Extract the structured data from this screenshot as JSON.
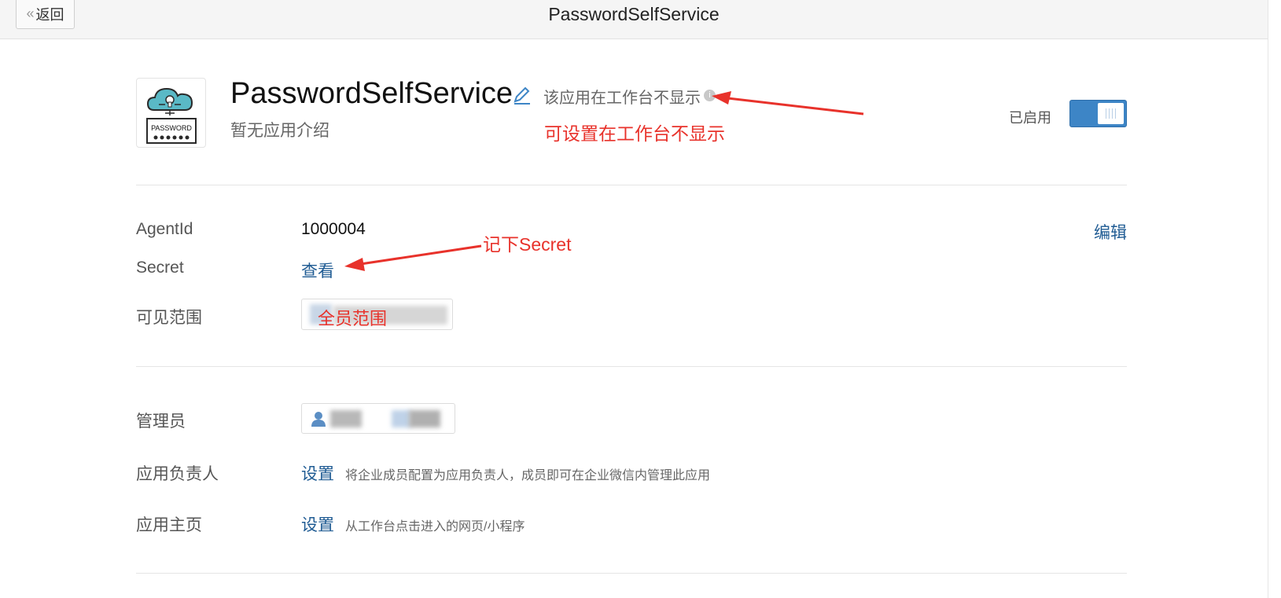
{
  "topbar": {
    "back_label": "返回",
    "title": "PasswordSelfService"
  },
  "app": {
    "name": "PasswordSelfService",
    "icon_text": "PASSWORD",
    "hide_note": "该应用在工作台不显示",
    "description": "暂无应用介绍",
    "enabled_label": "已启用",
    "enabled": true
  },
  "details": {
    "agentid_label": "AgentId",
    "agentid_value": "1000004",
    "edit_label": "编辑",
    "secret_label": "Secret",
    "secret_link": "查看",
    "scope_label": "可见范围"
  },
  "management": {
    "admin_label": "管理员",
    "owner_label": "应用负责人",
    "owner_link": "设置",
    "owner_hint": "将企业成员配置为应用负责人，成员即可在企业微信内管理此应用",
    "homepage_label": "应用主页",
    "homepage_link": "设置",
    "homepage_hint": "从工作台点击进入的网页/小程序"
  },
  "annotations": {
    "hide_note": "可设置在工作台不显示",
    "secret_note": "记下Secret",
    "scope_note": "全员范围"
  },
  "colors": {
    "accent": "#3d85c6",
    "link": "#1f5b93",
    "annotation": "#e8322b"
  }
}
